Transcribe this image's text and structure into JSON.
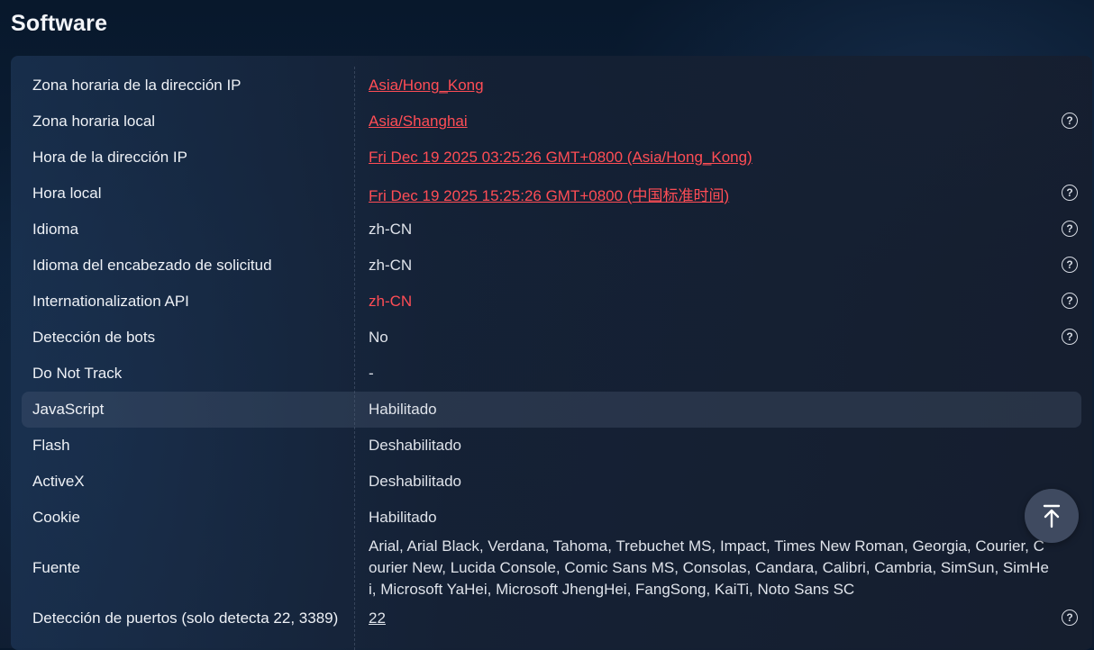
{
  "section": {
    "title": "Software"
  },
  "rows": [
    {
      "label": "Zona horaria de la dirección IP",
      "value": "Asia/Hong_Kong"
    },
    {
      "label": "Zona horaria local",
      "value": "Asia/Shanghai"
    },
    {
      "label": "Hora de la dirección IP",
      "value": "Fri Dec 19 2025 03:25:26 GMT+0800 (Asia/Hong_Kong)"
    },
    {
      "label": "Hora local",
      "value": "Fri Dec 19 2025 15:25:26 GMT+0800 (中国标准时间)"
    },
    {
      "label": "Idioma",
      "value": "zh-CN"
    },
    {
      "label": "Idioma del encabezado de solicitud",
      "value": "zh-CN"
    },
    {
      "label": "Internationalization API",
      "value": "zh-CN"
    },
    {
      "label": "Detección de bots",
      "value": "No"
    },
    {
      "label": "Do Not Track",
      "value": "-"
    },
    {
      "label": "JavaScript",
      "value": "Habilitado"
    },
    {
      "label": "Flash",
      "value": "Deshabilitado"
    },
    {
      "label": "ActiveX",
      "value": "Deshabilitado"
    },
    {
      "label": "Cookie",
      "value": "Habilitado"
    },
    {
      "label": "Fuente",
      "value": "Arial, Arial Black, Verdana, Tahoma, Trebuchet MS, Impact, Times New Roman, Georgia, Courier, Courier New, Lucida Console, Comic Sans MS, Consolas, Candara, Calibri, Cambria, SimSun, SimHei, Microsoft YaHei, Microsoft JhengHei, FangSong, KaiTi, Noto Sans SC"
    },
    {
      "label": "Detección de puertos (solo detecta 22, 3389)",
      "value": "22"
    }
  ],
  "help_glyph": "?",
  "colors": {
    "alert_red": "#ff4d55",
    "text": "#dfe3ea",
    "hover_row": "#3a4658"
  },
  "icons": {
    "help": "question-circle-icon",
    "scroll_top": "arrow-up-to-line-icon"
  }
}
